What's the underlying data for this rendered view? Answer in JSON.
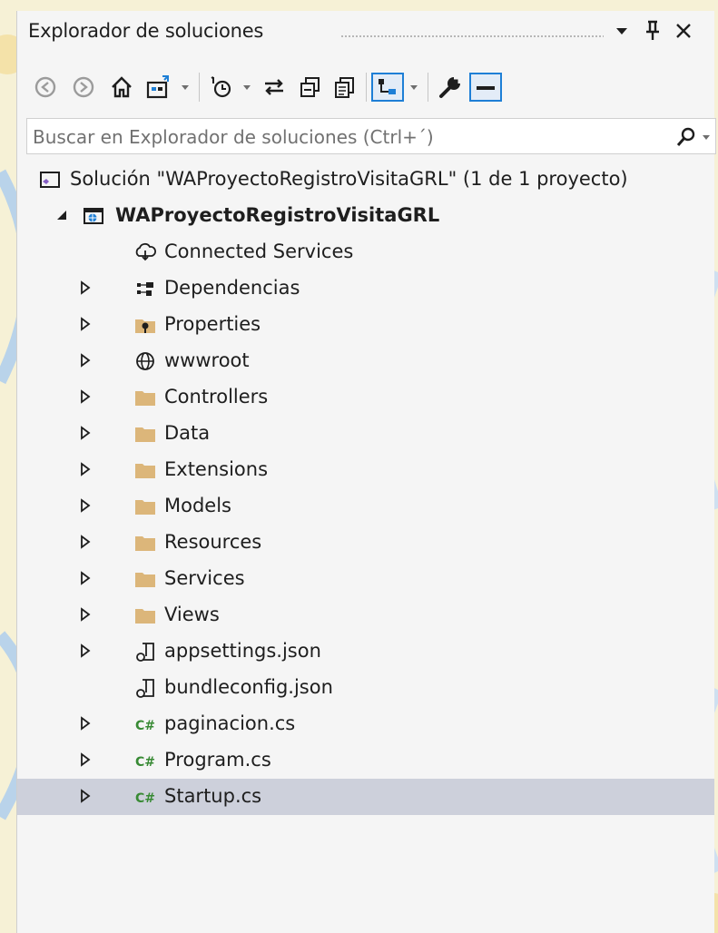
{
  "panel": {
    "title": "Explorador de soluciones",
    "search_placeholder": "Buscar en Explorador de soluciones (Ctrl+´)"
  },
  "tree": {
    "solution": "Solución \"WAProyectoRegistroVisitaGRL\" (1 de 1 proyecto)",
    "project": "WAProyectoRegistroVisitaGRL",
    "items": [
      {
        "label": "Connected Services",
        "icon": "connected-services-icon"
      },
      {
        "label": "Dependencias",
        "icon": "dependencies-icon"
      },
      {
        "label": "Properties",
        "icon": "properties-icon"
      },
      {
        "label": "wwwroot",
        "icon": "globe-icon"
      },
      {
        "label": "Controllers",
        "icon": "folder-icon"
      },
      {
        "label": "Data",
        "icon": "folder-icon"
      },
      {
        "label": "Extensions",
        "icon": "folder-icon"
      },
      {
        "label": "Models",
        "icon": "folder-icon"
      },
      {
        "label": "Resources",
        "icon": "folder-icon"
      },
      {
        "label": "Services",
        "icon": "folder-icon"
      },
      {
        "label": "Views",
        "icon": "folder-icon"
      },
      {
        "label": "appsettings.json",
        "icon": "json-file-icon"
      },
      {
        "label": "bundleconfig.json",
        "icon": "json-file-icon"
      },
      {
        "label": "paginacion.cs",
        "icon": "csharp-file-icon"
      },
      {
        "label": "Program.cs",
        "icon": "csharp-file-icon"
      },
      {
        "label": "Startup.cs",
        "icon": "csharp-file-icon"
      }
    ]
  },
  "colors": {
    "panel_bg": "#f5f5f5",
    "selected_row": "#cdd0db",
    "folder": "#dcb67a",
    "csharp": "#388a34",
    "accent_blue": "#1e7fd6",
    "text": "#1e1e1e"
  }
}
